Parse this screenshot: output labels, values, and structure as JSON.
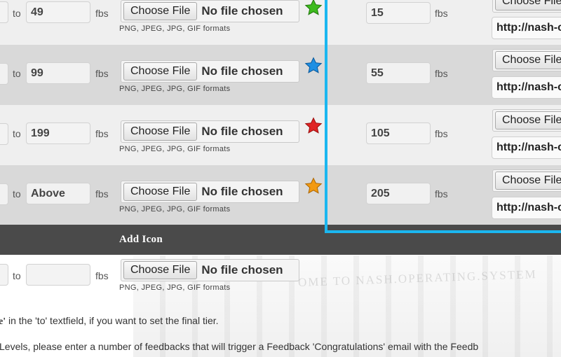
{
  "tiers": [
    {
      "to_value": "49",
      "fbs_label": "fbs",
      "to_label": "to",
      "file_button": "Choose File",
      "file_status": "No file chosen",
      "formats": "PNG, JPEG, JPG, GIF formats",
      "star_icon": "green-star-icon",
      "star_color": "#3dbb1e",
      "right_value": "15",
      "right_fbs": "fbs",
      "right_file_button": "Choose File",
      "url_value": "http://nash-c"
    },
    {
      "to_value": "99",
      "fbs_label": "fbs",
      "to_label": "to",
      "file_button": "Choose File",
      "file_status": "No file chosen",
      "formats": "PNG, JPEG, JPG, GIF formats",
      "star_icon": "blue-star-icon",
      "star_color": "#1e8fe3",
      "right_value": "55",
      "right_fbs": "fbs",
      "right_file_button": "Choose File",
      "url_value": "http://nash-c"
    },
    {
      "to_value": "199",
      "fbs_label": "fbs",
      "to_label": "to",
      "file_button": "Choose File",
      "file_status": "No file chosen",
      "formats": "PNG, JPEG, JPG, GIF formats",
      "star_icon": "red-star-icon",
      "star_color": "#e02424",
      "right_value": "105",
      "right_fbs": "fbs",
      "right_file_button": "Choose File",
      "url_value": "http://nash-c"
    },
    {
      "to_value": "Above",
      "fbs_label": "fbs",
      "to_label": "to",
      "file_button": "Choose File",
      "file_status": "No file chosen",
      "formats": "PNG, JPEG, JPG, GIF formats",
      "star_icon": "orange-star-icon",
      "star_color": "#f39a12",
      "right_value": "205",
      "right_fbs": "fbs",
      "right_file_button": "Choose File",
      "url_value": "http://nash-c"
    }
  ],
  "add_icon_label": "Add Icon",
  "new_tier": {
    "to_label": "to",
    "to_value": "",
    "fbs_label": "fbs",
    "file_button": "Choose File",
    "file_status": "No file chosen",
    "formats": "PNG, JPEG, JPG, GIF formats"
  },
  "background_text": "OME TO NASH.OPERATING.SYSTEM",
  "notes": {
    "line1": "e' in the 'to' textfield, if you want to set the final tier.",
    "line2": "Levels, please enter a number of feedbacks that will trigger a Feedback 'Congratulations' email with the Feedb"
  },
  "colors": {
    "panel_border": "#1bb7f0",
    "add_bar": "#4a4a4a"
  }
}
